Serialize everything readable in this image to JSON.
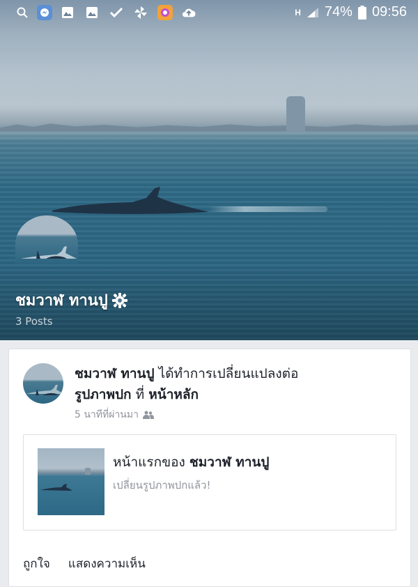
{
  "status_bar": {
    "icons": [
      "search-icon",
      "messenger-icon",
      "image-icon",
      "image-icon-2",
      "check-icon",
      "pinwheel-icon",
      "camera-app-icon",
      "cloud-upload-icon"
    ],
    "network_label": "H",
    "battery_percent": "74%",
    "time": "09:56"
  },
  "cover": {
    "page_name": "ชมวาฬ ทานปู",
    "posts_count": "3 Posts"
  },
  "post": {
    "author": "ชมวาฬ ทานปู",
    "action_text": "ได้ทำการเปลี่ยนแปลงต่อ",
    "object_text": "รูปภาพปก",
    "connector": "ที่",
    "target": "หน้าหลัก",
    "timestamp": "5 นาทีที่ผ่านมา",
    "share": {
      "title_prefix": "หน้าแรกของ",
      "title_page": "ชมวาฬ ทานปู",
      "subtitle": "เปลี่ยนรูปภาพปกแล้ว!"
    },
    "actions": {
      "like_label": "ถูกใจ",
      "comment_label": "แสดงความเห็น"
    }
  }
}
